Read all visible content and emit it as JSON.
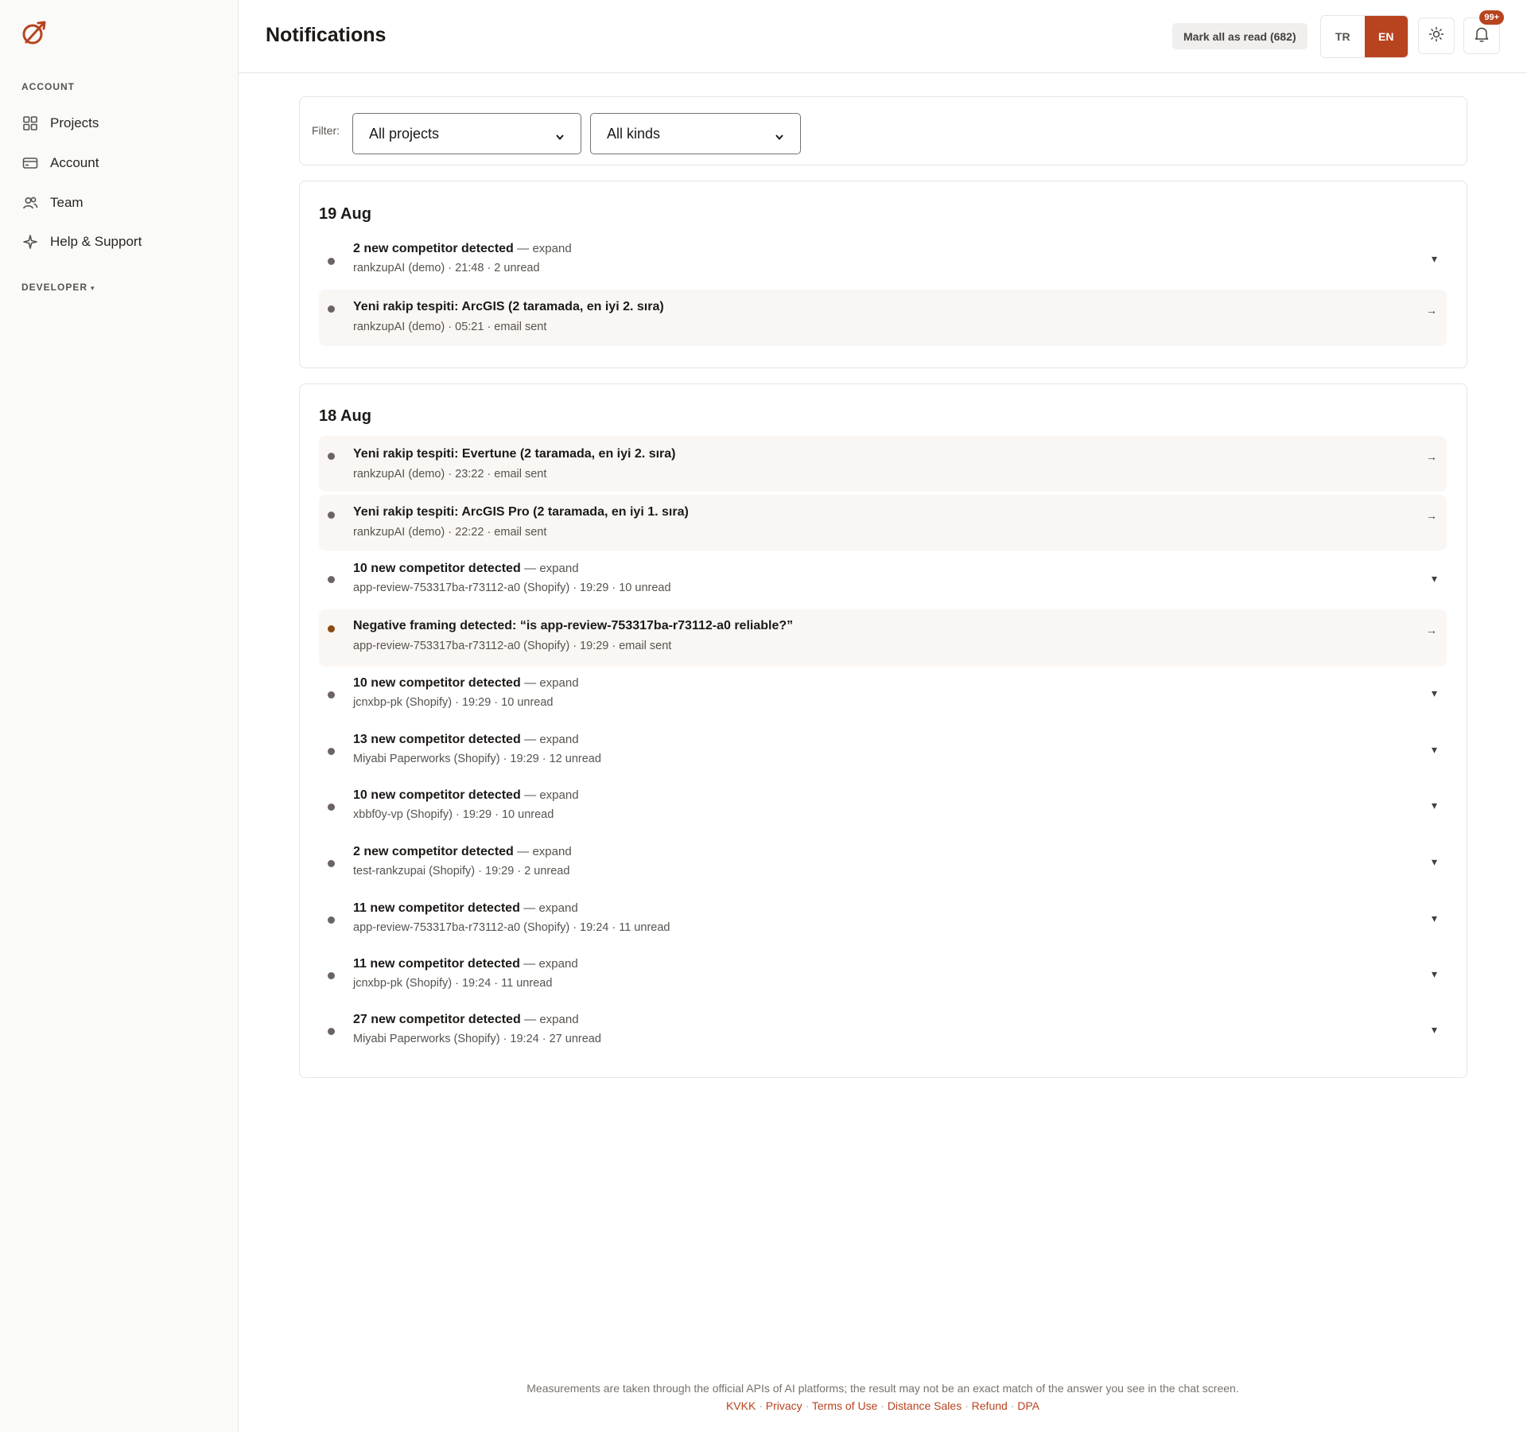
{
  "sidebar": {
    "logo_icon": "brand-logo-icon",
    "account_section": "ACCOUNT",
    "items": [
      {
        "label": "Projects",
        "icon": "grid-icon"
      },
      {
        "label": "Account",
        "icon": "card-icon"
      },
      {
        "label": "Team",
        "icon": "users-icon"
      },
      {
        "label": "Help & Support",
        "icon": "sparkle-icon"
      }
    ],
    "developer_section": "DEVELOPER",
    "developer_caret": "▾"
  },
  "header": {
    "title": "Notifications",
    "mark_all_read": "Mark all as read (682)",
    "lang_tr": "TR",
    "lang_en": "EN",
    "lang_active": "EN",
    "theme_icon": "sun-icon",
    "bell_icon": "bell-icon",
    "badge": "99+"
  },
  "filter": {
    "label": "Filter:",
    "project_select": "All projects",
    "kind_select": "All kinds"
  },
  "groups": [
    {
      "date": "19 Aug",
      "items": [
        {
          "title": "2 new competitor detected",
          "suffix": "— expand",
          "meta": "rankzupAI (demo) · 21:48 · 2 unread",
          "action": "▾",
          "highlight": false,
          "dot": "default"
        },
        {
          "title": "Yeni rakip tespiti: ArcGIS (2 taramada, en iyi 2. sıra)",
          "suffix": "",
          "meta": "rankzupAI (demo) · 05:21 · email sent",
          "action": "→",
          "highlight": true,
          "dot": "default"
        }
      ]
    },
    {
      "date": "18 Aug",
      "items": [
        {
          "title": "Yeni rakip tespiti: Evertune (2 taramada, en iyi 2. sıra)",
          "suffix": "",
          "meta": "rankzupAI (demo) · 23:22 · email sent",
          "action": "→",
          "highlight": true,
          "dot": "default"
        },
        {
          "title": "Yeni rakip tespiti: ArcGIS Pro (2 taramada, en iyi 1. sıra)",
          "suffix": "",
          "meta": "rankzupAI (demo) · 22:22 · email sent",
          "action": "→",
          "highlight": true,
          "dot": "default"
        },
        {
          "title": "10 new competitor detected",
          "suffix": "— expand",
          "meta": "app-review-753317ba-r73112-a0 (Shopify) · 19:29 · 10 unread",
          "action": "▾",
          "highlight": false,
          "dot": "default"
        },
        {
          "title": "Negative framing detected: “is app-review-753317ba-r73112-a0 reliable?”",
          "suffix": "",
          "meta": "app-review-753317ba-r73112-a0 (Shopify) · 19:29 · email sent",
          "action": "→",
          "highlight": true,
          "dot": "warn"
        },
        {
          "title": "10 new competitor detected",
          "suffix": "— expand",
          "meta": "jcnxbp-pk (Shopify) · 19:29 · 10 unread",
          "action": "▾",
          "highlight": false,
          "dot": "default"
        },
        {
          "title": "13 new competitor detected",
          "suffix": "— expand",
          "meta": "Miyabi Paperworks (Shopify) · 19:29 · 12 unread",
          "action": "▾",
          "highlight": false,
          "dot": "default"
        },
        {
          "title": "10 new competitor detected",
          "suffix": "— expand",
          "meta": "xbbf0y-vp (Shopify) · 19:29 · 10 unread",
          "action": "▾",
          "highlight": false,
          "dot": "default"
        },
        {
          "title": "2 new competitor detected",
          "suffix": "— expand",
          "meta": "test-rankzupai (Shopify) · 19:29 · 2 unread",
          "action": "▾",
          "highlight": false,
          "dot": "default"
        },
        {
          "title": "11 new competitor detected",
          "suffix": "— expand",
          "meta": "app-review-753317ba-r73112-a0 (Shopify) · 19:24 · 11 unread",
          "action": "▾",
          "highlight": false,
          "dot": "default"
        },
        {
          "title": "11 new competitor detected",
          "suffix": "— expand",
          "meta": "jcnxbp-pk (Shopify) · 19:24 · 11 unread",
          "action": "▾",
          "highlight": false,
          "dot": "default"
        },
        {
          "title": "27 new competitor detected",
          "suffix": "— expand",
          "meta": "Miyabi Paperworks (Shopify) · 19:24 · 27 unread",
          "action": "▾",
          "highlight": false,
          "dot": "default"
        }
      ]
    }
  ],
  "footer": {
    "note": "Measurements are taken through the official APIs of AI platforms; the result may not be an exact match of the answer you see in the chat screen.",
    "links": [
      "KVKK",
      "Privacy",
      "Terms of Use",
      "Distance Sales",
      "Refund",
      "DPA"
    ],
    "separator": " · "
  },
  "colors": {
    "accent": "#b8431f",
    "warn_dot": "#8a4b10"
  }
}
